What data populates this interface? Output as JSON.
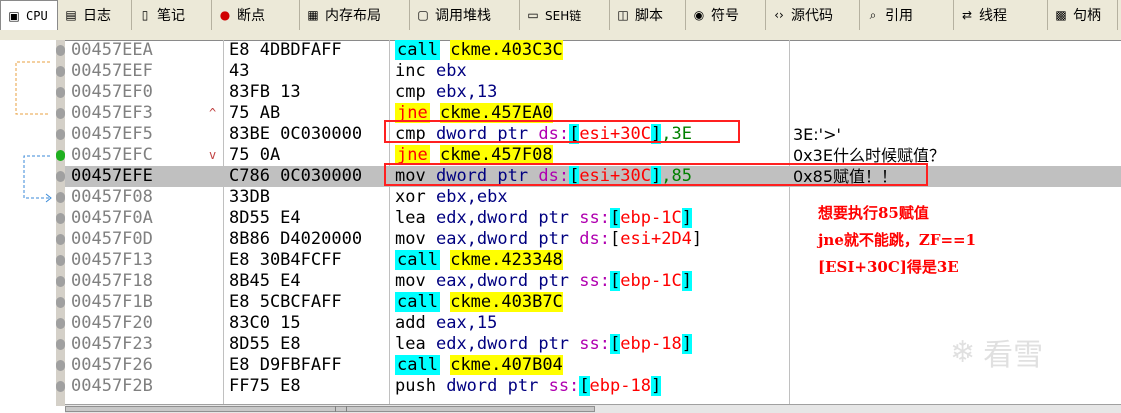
{
  "tabs": [
    {
      "id": "cpu",
      "icon": "cpu-icon",
      "label": "CPU",
      "active": true
    },
    {
      "id": "log",
      "icon": "log-icon",
      "label": "日志"
    },
    {
      "id": "notes",
      "icon": "notes-icon",
      "label": "笔记"
    },
    {
      "id": "breakpoints",
      "icon": "breakpoint-dot-icon",
      "label": "断点"
    },
    {
      "id": "memory",
      "icon": "memory-map-icon",
      "label": "内存布局"
    },
    {
      "id": "callstack",
      "icon": "call-stack-icon",
      "label": "调用堆栈"
    },
    {
      "id": "seh",
      "icon": "seh-chain-icon",
      "label": "SEH链"
    },
    {
      "id": "script",
      "icon": "script-icon",
      "label": "脚本"
    },
    {
      "id": "symbols",
      "icon": "symbols-icon",
      "label": "符号"
    },
    {
      "id": "source",
      "icon": "source-code-icon",
      "label": "源代码"
    },
    {
      "id": "references",
      "icon": "references-icon",
      "label": "引用"
    },
    {
      "id": "threads",
      "icon": "threads-icon",
      "label": "线程"
    },
    {
      "id": "handles",
      "icon": "handles-icon",
      "label": "句柄"
    }
  ],
  "rows": [
    {
      "addr": "00457EEA",
      "hex": "E8 4DBDFAFF",
      "mnem": "call",
      "type": "call",
      "operand": "ckme.403C3C"
    },
    {
      "addr": "00457EEF",
      "hex": "43",
      "mnem": "inc",
      "type": "plain",
      "operand": "ebx"
    },
    {
      "addr": "00457EF0",
      "hex": "83FB 13",
      "mnem": "cmp",
      "type": "plain",
      "operand": "ebx,13"
    },
    {
      "addr": "00457EF3",
      "hex": "75 AB",
      "mnem": "jne",
      "type": "jne",
      "operand": "ckme.457EA0",
      "jump_arrow": "^"
    },
    {
      "addr": "00457EF5",
      "hex": "83BE 0C030000",
      "mnem": "cmp",
      "type": "mem",
      "ptr": "dword ptr",
      "seg": "ds:",
      "inner": "esi+30C",
      "suffix": ",3E",
      "comment": "3E:'>'"
    },
    {
      "addr": "00457EFC",
      "hex": "75 0A",
      "mnem": "jne",
      "type": "jne",
      "operand": "ckme.457F08",
      "jump_arrow": "v",
      "comment": "0x3E什么时候赋值？"
    },
    {
      "addr": "00457EFE",
      "hex": "C786 0C030000",
      "mnem": "mov",
      "type": "mem",
      "ptr": "dword ptr",
      "seg": "ds:",
      "inner": "esi+30C",
      "suffix": ",85",
      "comment": "0x85赋值！！",
      "current": true
    },
    {
      "addr": "00457F08",
      "hex": "33DB",
      "mnem": "xor",
      "type": "plain",
      "operand": "ebx,ebx"
    },
    {
      "addr": "00457F0A",
      "hex": "8D55 E4",
      "mnem": "lea",
      "type": "mem",
      "prefix": "edx,",
      "ptr": "dword ptr",
      "seg": "ss:",
      "inner": "ebp-1C",
      "suffix": ""
    },
    {
      "addr": "00457F0D",
      "hex": "8B86 D4020000",
      "mnem": "mov",
      "type": "mem",
      "prefix": "eax,",
      "ptr": "dword ptr",
      "seg": "ds:",
      "inner": "esi+2D4",
      "suffix": "",
      "plain_brackets": true
    },
    {
      "addr": "00457F13",
      "hex": "E8 30B4FCFF",
      "mnem": "call",
      "type": "call",
      "operand": "ckme.423348"
    },
    {
      "addr": "00457F18",
      "hex": "8B45 E4",
      "mnem": "mov",
      "type": "mem",
      "prefix": "eax,",
      "ptr": "dword ptr",
      "seg": "ss:",
      "inner": "ebp-1C",
      "suffix": ""
    },
    {
      "addr": "00457F1B",
      "hex": "E8 5CBCFAFF",
      "mnem": "call",
      "type": "call",
      "operand": "ckme.403B7C"
    },
    {
      "addr": "00457F20",
      "hex": "83C0 15",
      "mnem": "add",
      "type": "plain",
      "operand": "eax,15"
    },
    {
      "addr": "00457F23",
      "hex": "8D55 E8",
      "mnem": "lea",
      "type": "mem",
      "prefix": "edx,",
      "ptr": "dword ptr",
      "seg": "ss:",
      "inner": "ebp-18",
      "suffix": ""
    },
    {
      "addr": "00457F26",
      "hex": "E8 D9FBFAFF",
      "mnem": "call",
      "type": "call",
      "operand": "ckme.407B04"
    },
    {
      "addr": "00457F2B",
      "hex": "FF75 E8",
      "mnem": "push",
      "type": "mem",
      "prefix": "",
      "ptr": "dword ptr",
      "seg": "ss:",
      "inner": "ebp-18",
      "suffix": ""
    }
  ],
  "annotation": {
    "line1": "想要执行85赋值",
    "line2": "jne就不能跳，ZF==1",
    "line3": "[ESI+30C]得是3E"
  },
  "watermark": {
    "text": "看雪"
  },
  "colors": {
    "call_bg": "#00ffff",
    "jne_bg": "#ffff00",
    "jne_fg": "#ff0000",
    "highlight_box": "#ff2020",
    "current_row": "#c0c0c0",
    "annotation": "#ff0000"
  }
}
